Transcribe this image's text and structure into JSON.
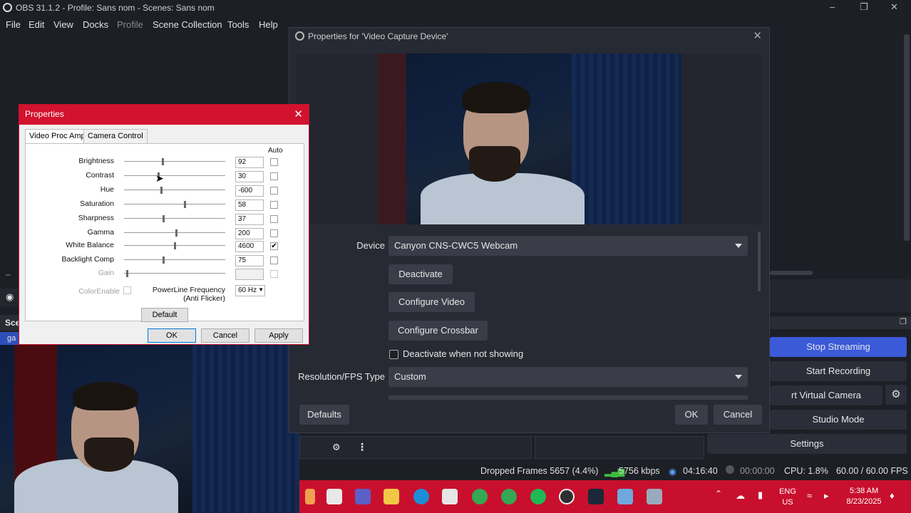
{
  "app": {
    "title": "OBS 31.1.2 - Profile: Sans nom - Scenes: Sans nom",
    "menu": [
      "File",
      "Edit",
      "View",
      "Docks",
      "Profile",
      "Scene Collection",
      "Tools",
      "Help"
    ],
    "scenes_label": "Sce",
    "scene_item_partial": "ga"
  },
  "controls": {
    "stop_streaming": "Stop Streaming",
    "start_recording": "Start Recording",
    "virtual_camera": "rt Virtual Camera",
    "studio_mode": "Studio Mode",
    "settings": "Settings"
  },
  "statusbar": {
    "dropped_frames": "Dropped Frames 5657 (4.4%)",
    "bitrate": "5756 kbps",
    "stream_time": "04:16:40",
    "record_time": "00:00:00",
    "cpu": "CPU: 1.8%",
    "fps": "60.00 / 60.00 FPS"
  },
  "taskbar": {
    "lang": "ENG",
    "region": "US",
    "time": "5:38 AM",
    "date": "8/23/2025"
  },
  "obs_props": {
    "title": "Properties for 'Video Capture Device'",
    "device_label": "Device",
    "device_value": "Canyon CNS-CWC5 Webcam",
    "deactivate": "Deactivate",
    "configure_video": "Configure Video",
    "configure_crossbar": "Configure Crossbar",
    "deactivate_when_not_showing": "Deactivate when not showing",
    "res_fps_label": "Resolution/FPS Type",
    "res_fps_value": "Custom",
    "defaults": "Defaults",
    "ok": "OK",
    "cancel": "Cancel"
  },
  "win_dialog": {
    "title": "Properties",
    "tabs": [
      "Video Proc Amp",
      "Camera Control"
    ],
    "auto_label": "Auto",
    "rows": [
      {
        "label": "Brightness",
        "value": "92",
        "level": 0.37,
        "auto": false,
        "disabled": false
      },
      {
        "label": "Contrast",
        "value": "30",
        "level": 0.33,
        "auto": false,
        "disabled": false
      },
      {
        "label": "Hue",
        "value": "-600",
        "level": 0.36,
        "auto": false,
        "disabled": false
      },
      {
        "label": "Saturation",
        "value": "58",
        "level": 0.59,
        "auto": false,
        "disabled": false
      },
      {
        "label": "Sharpness",
        "value": "37",
        "level": 0.38,
        "auto": false,
        "disabled": false
      },
      {
        "label": "Gamma",
        "value": "200",
        "level": 0.51,
        "auto": false,
        "disabled": false
      },
      {
        "label": "White Balance",
        "value": "4600",
        "level": 0.49,
        "auto": true,
        "disabled": false
      },
      {
        "label": "Backlight Comp",
        "value": "75",
        "level": 0.38,
        "auto": false,
        "disabled": false
      },
      {
        "label": "Gain",
        "value": "",
        "level": 0.02,
        "auto": false,
        "disabled": true
      }
    ],
    "color_enable": "ColorEnable",
    "powerline_label_1": "PowerLine Frequency",
    "powerline_label_2": "(Anti Flicker)",
    "powerline_value": "60 Hz",
    "default_btn": "Default",
    "ok": "OK",
    "cancel": "Cancel",
    "apply": "Apply"
  }
}
